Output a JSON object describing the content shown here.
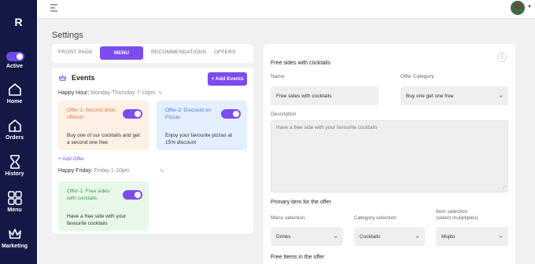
{
  "sidebar": {
    "logo": "R",
    "active_label": "Active",
    "items": [
      {
        "label": "Home",
        "icon": "home-icon"
      },
      {
        "label": "Orders",
        "icon": "orders-icon"
      },
      {
        "label": "History",
        "icon": "hourglass-icon"
      },
      {
        "label": "Menu",
        "icon": "grid-icon"
      },
      {
        "label": "Marketing",
        "icon": "crown-icon"
      }
    ]
  },
  "header": {
    "title": "Settings"
  },
  "tabs": [
    {
      "label": "FRONT PAGE"
    },
    {
      "label": "MENU"
    },
    {
      "label": "RECOMMENDATIONS"
    },
    {
      "label": "OFFERS"
    }
  ],
  "events": {
    "title": "Events",
    "add_button": "+ Add Events",
    "groups": [
      {
        "name": "Happy Hour:",
        "schedule": "Monday-Thursday 7-10pm",
        "offers": [
          {
            "name": "Offer-1: Second drink offered",
            "desc": "Buy one of our cocktails and get a second one free"
          },
          {
            "name": "Offer-2: Discount on Pizzas",
            "desc": "Enjoy your favourite pizzas at 15% discount"
          }
        ],
        "add_offer": "+ Add Offer"
      },
      {
        "name": "Happy Friday:",
        "schedule": "Friday 1-10pm",
        "offers": [
          {
            "name": "Offer-1: Free sides with cocktails",
            "desc": "Have a free side with your favourite cocktails"
          }
        ]
      }
    ]
  },
  "detail": {
    "title": "Free sides with cocktails",
    "name_label": "Name",
    "name_value": "Free sides with cocktails",
    "category_label": "Offer Category",
    "category_value": "Buy one get one free",
    "description_label": "Description",
    "description_placeholder": "Have a free side with your favourite cocktails",
    "primary_title": "Primary item for the offer",
    "menu_label": "Menu selection",
    "menu_value": "Drinks",
    "cat_sel_label": "Category selection",
    "cat_sel_value": "Cocktails",
    "item_label_1": "Item selection",
    "item_label_2": "(select muliptiples)",
    "item_value": "Mojito",
    "free_title": "Free Items in the offer"
  },
  "colors": {
    "sidebar": "#131845",
    "accent": "#7b4cf0",
    "offer_orange": "#fdf0e4",
    "offer_blue": "#e4efff",
    "offer_green": "#e7f7e8"
  }
}
